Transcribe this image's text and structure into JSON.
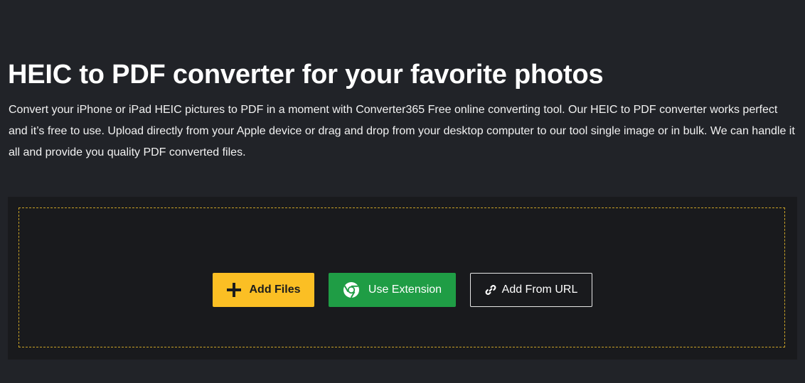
{
  "hero": {
    "title": "HEIC to PDF converter for your favorite photos",
    "description": "Convert your iPhone or iPad HEIC pictures to PDF in a moment with Converter365 Free online converting tool. Our HEIC to PDF converter works perfect and it’s free to use. Upload directly from your Apple device or drag and drop from your desktop computer to our tool single image or in bulk. We can handle it all and provide you quality PDF converted files."
  },
  "upload": {
    "add_files_label": "Add Files",
    "use_extension_label": "Use Extension",
    "add_from_url_label": "Add From URL"
  },
  "icons": {
    "add_files": "plus-icon",
    "use_extension": "chrome-icon",
    "add_from_url": "link-icon"
  },
  "colors": {
    "background": "#212328",
    "panel": "#191a1d",
    "dashed_border": "#c9a227",
    "add_files_button": "#fbbf24",
    "use_extension_button": "#1f9d45",
    "url_button_border": "#e6e6e6"
  }
}
